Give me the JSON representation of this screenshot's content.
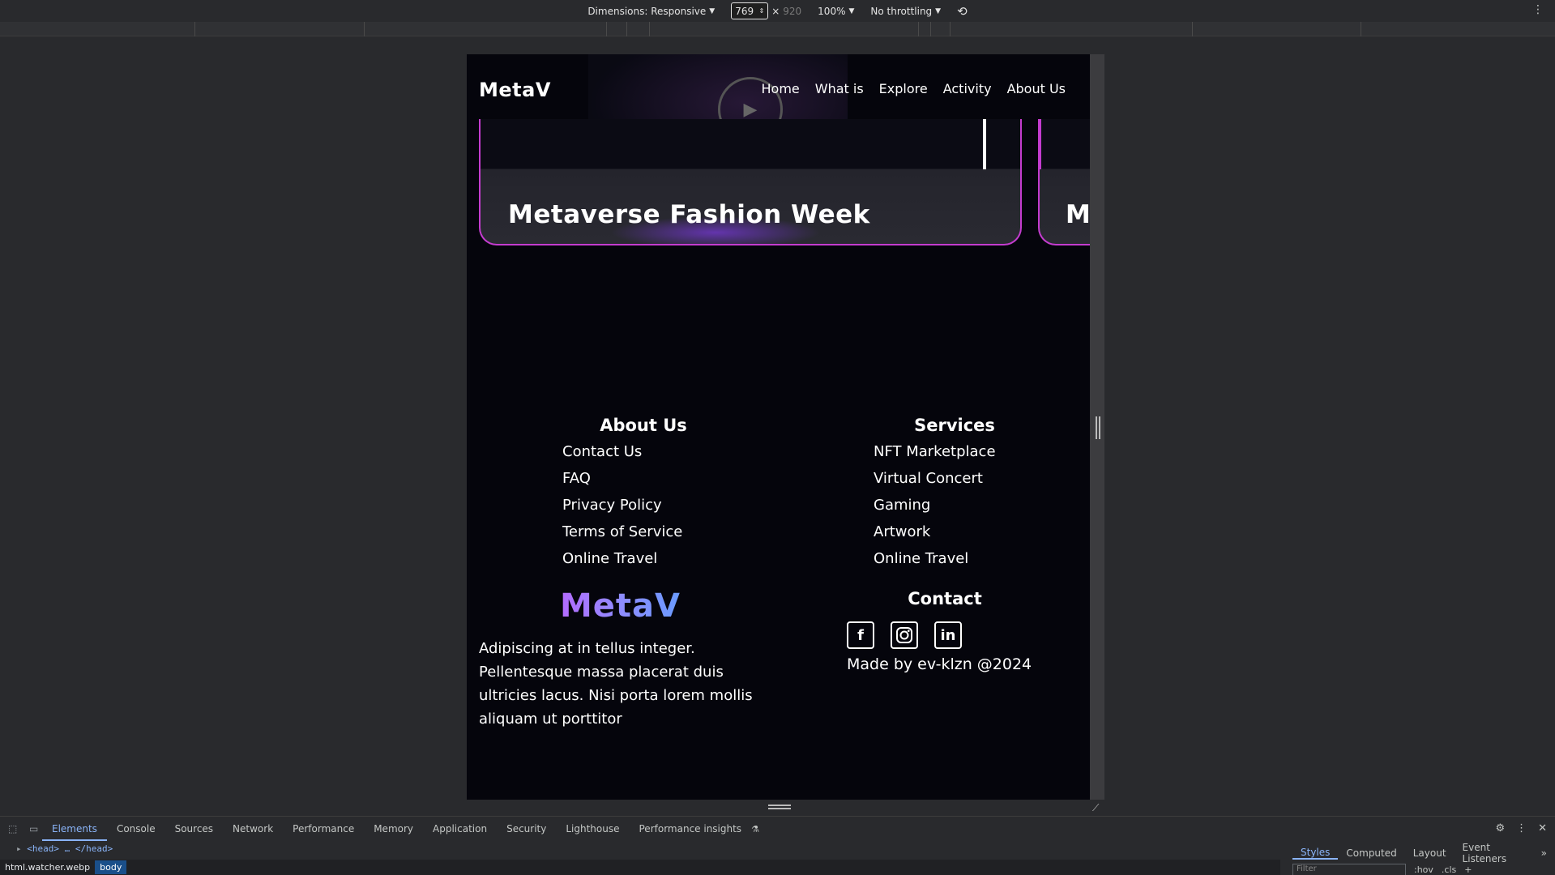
{
  "devtools_toolbar": {
    "dimensions_label": "Dimensions: Responsive",
    "width": "769",
    "height": "920",
    "zoom": "100%",
    "throttling": "No throttling"
  },
  "site": {
    "logo": "MetaV",
    "nav": [
      "Home",
      "What is",
      "Explore",
      "Activity",
      "About Us"
    ],
    "card_title": "Metaverse Fashion Week",
    "card2_title": "Me",
    "footer": {
      "about_title": "About Us",
      "about_links": [
        "Contact Us",
        "FAQ",
        "Privacy Policy",
        "Terms of Service",
        "Online Travel"
      ],
      "services_title": "Services",
      "services_links": [
        "NFT Marketplace",
        "Virtual Concert",
        "Gaming",
        "Artwork",
        "Online Travel"
      ],
      "brand": "MetaV",
      "blurb": "Adipiscing at in tellus integer. Pellentesque massa placerat duis ultricies lacus. Nisi porta lorem mollis aliquam ut porttitor",
      "contact_title": "Contact",
      "socials": [
        "facebook-icon",
        "instagram-icon",
        "linkedin-icon"
      ],
      "made_by": "Made by ev-klzn @2024"
    }
  },
  "devtools_bottom": {
    "tabs": [
      "Elements",
      "Console",
      "Sources",
      "Network",
      "Performance",
      "Memory",
      "Application",
      "Security",
      "Lighthouse",
      "Performance insights"
    ],
    "dom_line": "<head> … </head>",
    "breadcrumbs": [
      "html.watcher.webp",
      "body"
    ],
    "side_tabs": [
      "Styles",
      "Computed",
      "Layout",
      "Event Listeners"
    ],
    "filter_placeholder": "Filter",
    "filter_tools": [
      ":hov",
      ".cls"
    ]
  },
  "colors": {
    "accent_border": "#c43ccf",
    "devtools_active": "#8ab4f8"
  }
}
